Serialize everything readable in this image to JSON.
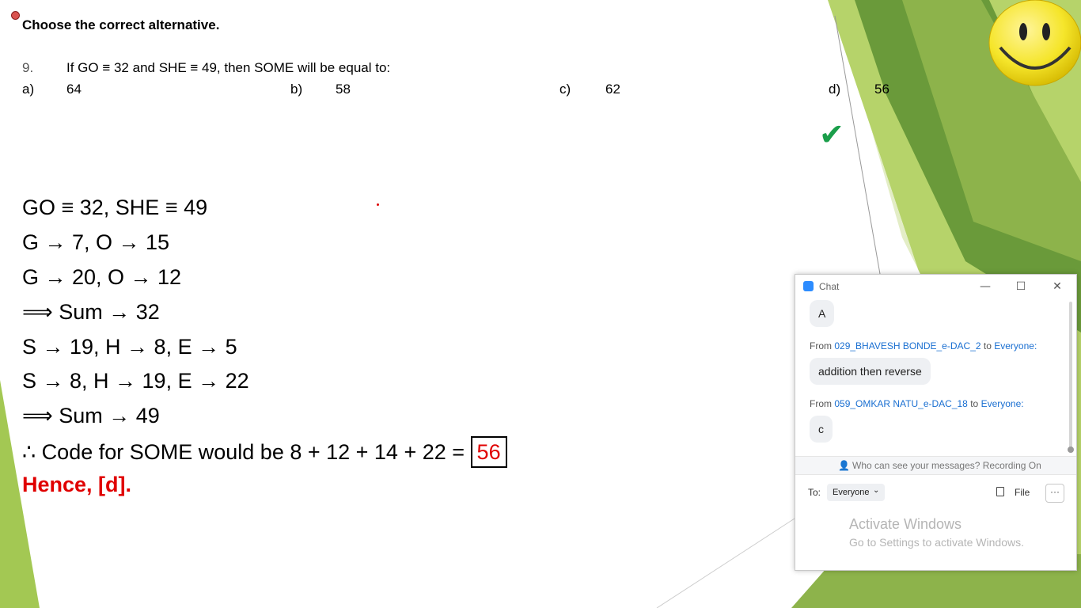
{
  "slide": {
    "heading": "Choose the correct alternative.",
    "question": {
      "number": "9.",
      "text": "If GO ≡ 32 and SHE ≡ 49, then SOME will be equal to:"
    },
    "options": [
      {
        "letter": "a)",
        "value": "64"
      },
      {
        "letter": "b)",
        "value": "58"
      },
      {
        "letter": "c)",
        "value": "62"
      },
      {
        "letter": "d)",
        "value": "56"
      }
    ],
    "solution_lines": [
      "GO ≡ 32, SHE ≡ 49",
      "G → 7, O → 15",
      "G → 20, O → 12",
      "⟹ Sum → 32",
      "S →  19, H → 8, E → 5",
      "S → 8, H → 19, E → 22",
      "⟹  Sum → 49"
    ],
    "final_line_prefix": "∴ Code for SOME would be 8 + 12 + 14 + 22 =",
    "final_answer": "56",
    "conclusion": "Hence, [d].",
    "checkmark": "✔",
    "colors": {
      "accent_red": "#e00000",
      "check_green": "#1a9e4a",
      "green_light": "#9dc84a",
      "green_dark": "#6a9a3a"
    }
  },
  "chat": {
    "title": "Chat",
    "window_controls": [
      "minimize",
      "maximize",
      "close"
    ],
    "messages": [
      {
        "from": "",
        "to": "",
        "text": "A"
      },
      {
        "from": "029_BHAVESH BONDE_e-DAC_2",
        "to": "Everyone:",
        "text": "addition then reverse"
      },
      {
        "from": "059_OMKAR NATU_e-DAC_18",
        "to": "Everyone:",
        "text": "c"
      }
    ],
    "from_word": "From",
    "to_word": "to",
    "privacy_text": "Who can see your messages? Recording On",
    "to_label": "To:",
    "recipient": "Everyone",
    "file_label": "File",
    "more_label": "···"
  },
  "watermark": {
    "title": "Activate Windows",
    "subtitle": "Go to Settings to activate Windows."
  }
}
